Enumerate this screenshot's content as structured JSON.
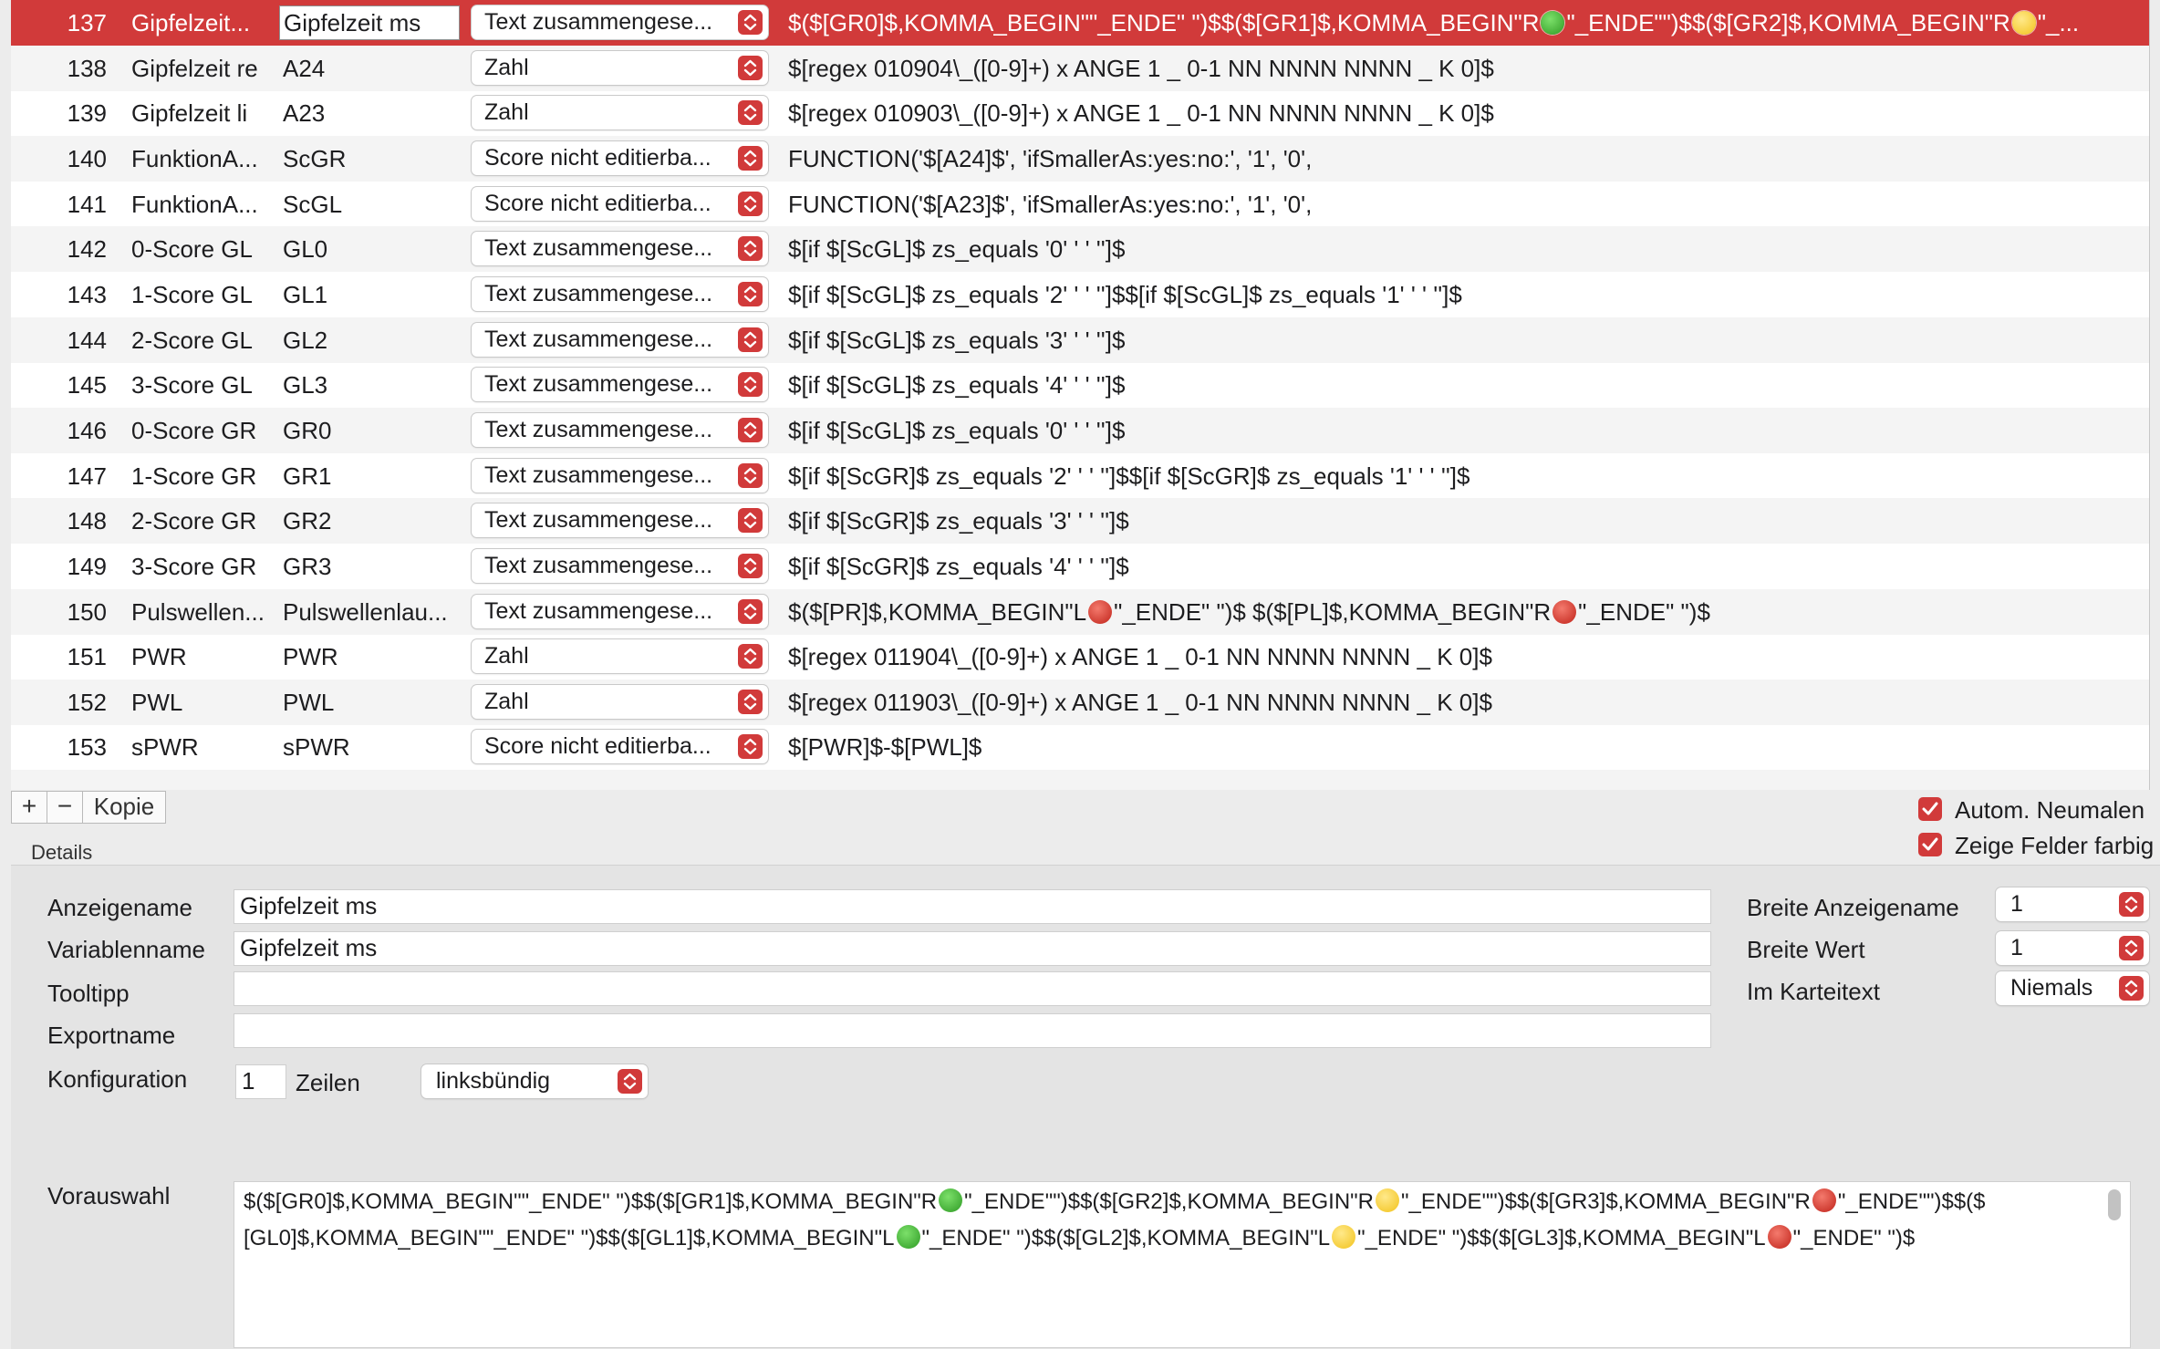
{
  "colors": {
    "accent": "#d13a3a",
    "selected_row": "#d13a3a"
  },
  "table": {
    "rows": [
      {
        "num": "137",
        "name": "Gipfelzeit...",
        "var": "Gipfelzeit ms",
        "type": "Text zusammengese...",
        "formula": [
          {
            "t": "$($[GR0]$,KOMMA_BEGIN\"\"_ENDE\"  \")$$($[GR1]$,KOMMA_BEGIN\"R"
          },
          {
            "dot": "green"
          },
          {
            "t": "\"_ENDE\"\")$$($[GR2]$,KOMMA_BEGIN\"R"
          },
          {
            "dot": "yellow"
          },
          {
            "t": "\"_..."
          }
        ],
        "selected": true
      },
      {
        "num": "138",
        "name": "Gipfelzeit re",
        "var": "A24",
        "type": "Zahl",
        "formula": [
          {
            "t": "$[regex 010904\\_([0-9]+) x ANGE 1 _ 0-1 NN NNNN NNNN _ K 0]$"
          }
        ]
      },
      {
        "num": "139",
        "name": "Gipfelzeit li",
        "var": "A23",
        "type": "Zahl",
        "formula": [
          {
            "t": "$[regex 010903\\_([0-9]+) x ANGE 1 _ 0-1 NN NNNN NNNN _ K 0]$"
          }
        ]
      },
      {
        "num": "140",
        "name": "FunktionA...",
        "var": "ScGR",
        "type": "Score nicht editierba...",
        "formula": [
          {
            "t": "FUNCTION('$[A24]$', 'ifSmallerAs:yes:no:', '1', '0',"
          }
        ]
      },
      {
        "num": "141",
        "name": "FunktionA...",
        "var": "ScGL",
        "type": "Score nicht editierba...",
        "formula": [
          {
            "t": "FUNCTION('$[A23]$', 'ifSmallerAs:yes:no:', '1', '0',"
          }
        ]
      },
      {
        "num": "142",
        "name": "0-Score GL",
        "var": "GL0",
        "type": "Text zusammengese...",
        "formula": [
          {
            "t": "$[if $[ScGL]$ zs_equals '0' ' ' '']$"
          }
        ]
      },
      {
        "num": "143",
        "name": "1-Score GL",
        "var": "GL1",
        "type": "Text zusammengese...",
        "formula": [
          {
            "t": "$[if $[ScGL]$ zs_equals '2' ' ' '']$$[if $[ScGL]$ zs_equals '1' ' ' '']$"
          }
        ]
      },
      {
        "num": "144",
        "name": "2-Score GL",
        "var": "GL2",
        "type": "Text zusammengese...",
        "formula": [
          {
            "t": "$[if $[ScGL]$ zs_equals '3' ' ' '']$"
          }
        ]
      },
      {
        "num": "145",
        "name": "3-Score GL",
        "var": "GL3",
        "type": "Text zusammengese...",
        "formula": [
          {
            "t": "$[if $[ScGL]$ zs_equals '4' ' ' '']$"
          }
        ]
      },
      {
        "num": "146",
        "name": "0-Score GR",
        "var": "GR0",
        "type": "Text zusammengese...",
        "formula": [
          {
            "t": "$[if $[ScGL]$ zs_equals '0' ' ' '']$"
          }
        ]
      },
      {
        "num": "147",
        "name": "1-Score GR",
        "var": "GR1",
        "type": "Text zusammengese...",
        "formula": [
          {
            "t": "$[if $[ScGR]$ zs_equals '2' ' ' '']$$[if $[ScGR]$ zs_equals '1' ' ' '']$"
          }
        ]
      },
      {
        "num": "148",
        "name": "2-Score GR",
        "var": "GR2",
        "type": "Text zusammengese...",
        "formula": [
          {
            "t": "$[if $[ScGR]$ zs_equals '3' ' ' '']$"
          }
        ]
      },
      {
        "num": "149",
        "name": "3-Score GR",
        "var": "GR3",
        "type": "Text zusammengese...",
        "formula": [
          {
            "t": "$[if $[ScGR]$ zs_equals '4' ' ' '']$"
          }
        ]
      },
      {
        "num": "150",
        "name": "Pulswellen...",
        "var": "Pulswellenlau...",
        "type": "Text zusammengese...",
        "formula": [
          {
            "t": "$($[PR]$,KOMMA_BEGIN\"L"
          },
          {
            "dot": "red"
          },
          {
            "t": "\"_ENDE\" \")$        $($[PL]$,KOMMA_BEGIN\"R"
          },
          {
            "dot": "red"
          },
          {
            "t": "\"_ENDE\"  \")$"
          }
        ]
      },
      {
        "num": "151",
        "name": "PWR",
        "var": "PWR",
        "type": "Zahl",
        "formula": [
          {
            "t": "$[regex 011904\\_([0-9]+) x ANGE 1 _ 0-1 NN NNNN NNNN _ K 0]$"
          }
        ]
      },
      {
        "num": "152",
        "name": "PWL",
        "var": "PWL",
        "type": "Zahl",
        "formula": [
          {
            "t": "$[regex 011903\\_([0-9]+) x ANGE 1 _ 0-1 NN NNNN NNNN _ K 0]$"
          }
        ]
      },
      {
        "num": "153",
        "name": "sPWR",
        "var": "sPWR",
        "type": "Score nicht editierba...",
        "formula": [
          {
            "t": "$[PWR]$-$[PWL]$"
          }
        ]
      }
    ]
  },
  "toolbar": {
    "add": "+",
    "remove": "−",
    "copy": "Kopie"
  },
  "options": {
    "auto_repaint": "Autom. Neumalen",
    "color_fields": "Zeige Felder farbig"
  },
  "details": {
    "title": "Details",
    "display_name_label": "Anzeigename",
    "display_name_value": "Gipfelzeit ms",
    "variable_name_label": "Variablenname",
    "variable_name_value": "Gipfelzeit ms",
    "tooltip_label": "Tooltipp",
    "tooltip_value": "",
    "export_name_label": "Exportname",
    "export_name_value": "",
    "config_label": "Konfiguration",
    "config_lines": "1",
    "config_lines_label": "Zeilen",
    "alignment": "linksbündig",
    "width_name_label": "Breite Anzeigename",
    "width_name_value": "1",
    "width_value_label": "Breite Wert",
    "width_value_value": "1",
    "card_text_label": "Im Karteitext",
    "card_text_value": "Niemals",
    "preselection_label": "Vorauswahl",
    "preselection_line1": [
      {
        "t": "$($[GR0]$,KOMMA_BEGIN\"\"_ENDE\"  \")$$($[GR1]$,KOMMA_BEGIN\"R"
      },
      {
        "dot": "green"
      },
      {
        "t": "\"_ENDE\"\")$$($[GR2]$,KOMMA_BEGIN\"R"
      },
      {
        "dot": "yellow"
      },
      {
        "t": "\"_ENDE\"\")$$($[GR3]$,KOMMA_BEGIN\"R"
      },
      {
        "dot": "red"
      },
      {
        "t": "\"_ENDE\"\")$$($"
      }
    ],
    "preselection_line2": [
      {
        "t": "[GL0]$,KOMMA_BEGIN\"\"_ENDE\"  \")$$($[GL1]$,KOMMA_BEGIN\"L"
      },
      {
        "dot": "green"
      },
      {
        "t": "\"_ENDE\"  \")$$($[GL2]$,KOMMA_BEGIN\"L"
      },
      {
        "dot": "yellow"
      },
      {
        "t": "\"_ENDE\"  \")$$($[GL3]$,KOMMA_BEGIN\"L"
      },
      {
        "dot": "red"
      },
      {
        "t": "\"_ENDE\"  \")$"
      }
    ]
  }
}
